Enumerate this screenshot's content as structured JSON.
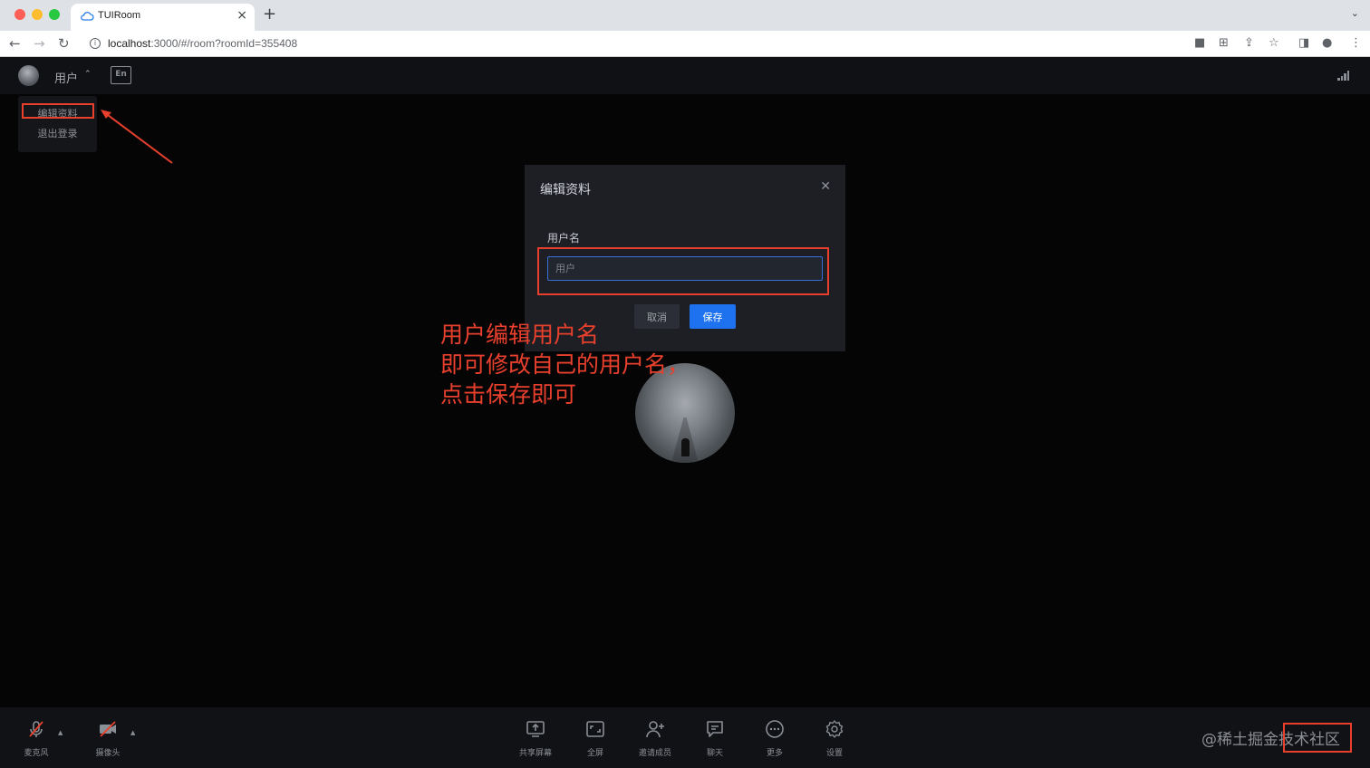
{
  "browser": {
    "tab_title": "TUIRoom",
    "url_host": "localhost",
    "url_rest": ":3000/#/room?roomId=355408"
  },
  "header": {
    "user_name": "用户",
    "lang_icon": "En"
  },
  "dropdown": {
    "edit_profile": "编辑资料",
    "logout": "退出登录"
  },
  "modal": {
    "title": "编辑资料",
    "field_label": "用户名",
    "input_value": "",
    "input_placeholder": "用户",
    "cancel_label": "取消",
    "save_label": "保存"
  },
  "annotation": "用户编辑用户名\n即可修改自己的用户名，\n点击保存即可",
  "toolbar": {
    "mic_label": "麦克风",
    "camera_label": "摄像头",
    "share_label": "共享屏幕",
    "fullscreen_label": "全屏",
    "invite_label": "邀请成员",
    "chat_label": "聊天",
    "more_label": "更多",
    "settings_label": "设置"
  },
  "watermark": "@稀土掘金技术社区",
  "colors": {
    "accent": "#1e72f0",
    "annotation_red": "#e8402d",
    "background": "#050506"
  }
}
